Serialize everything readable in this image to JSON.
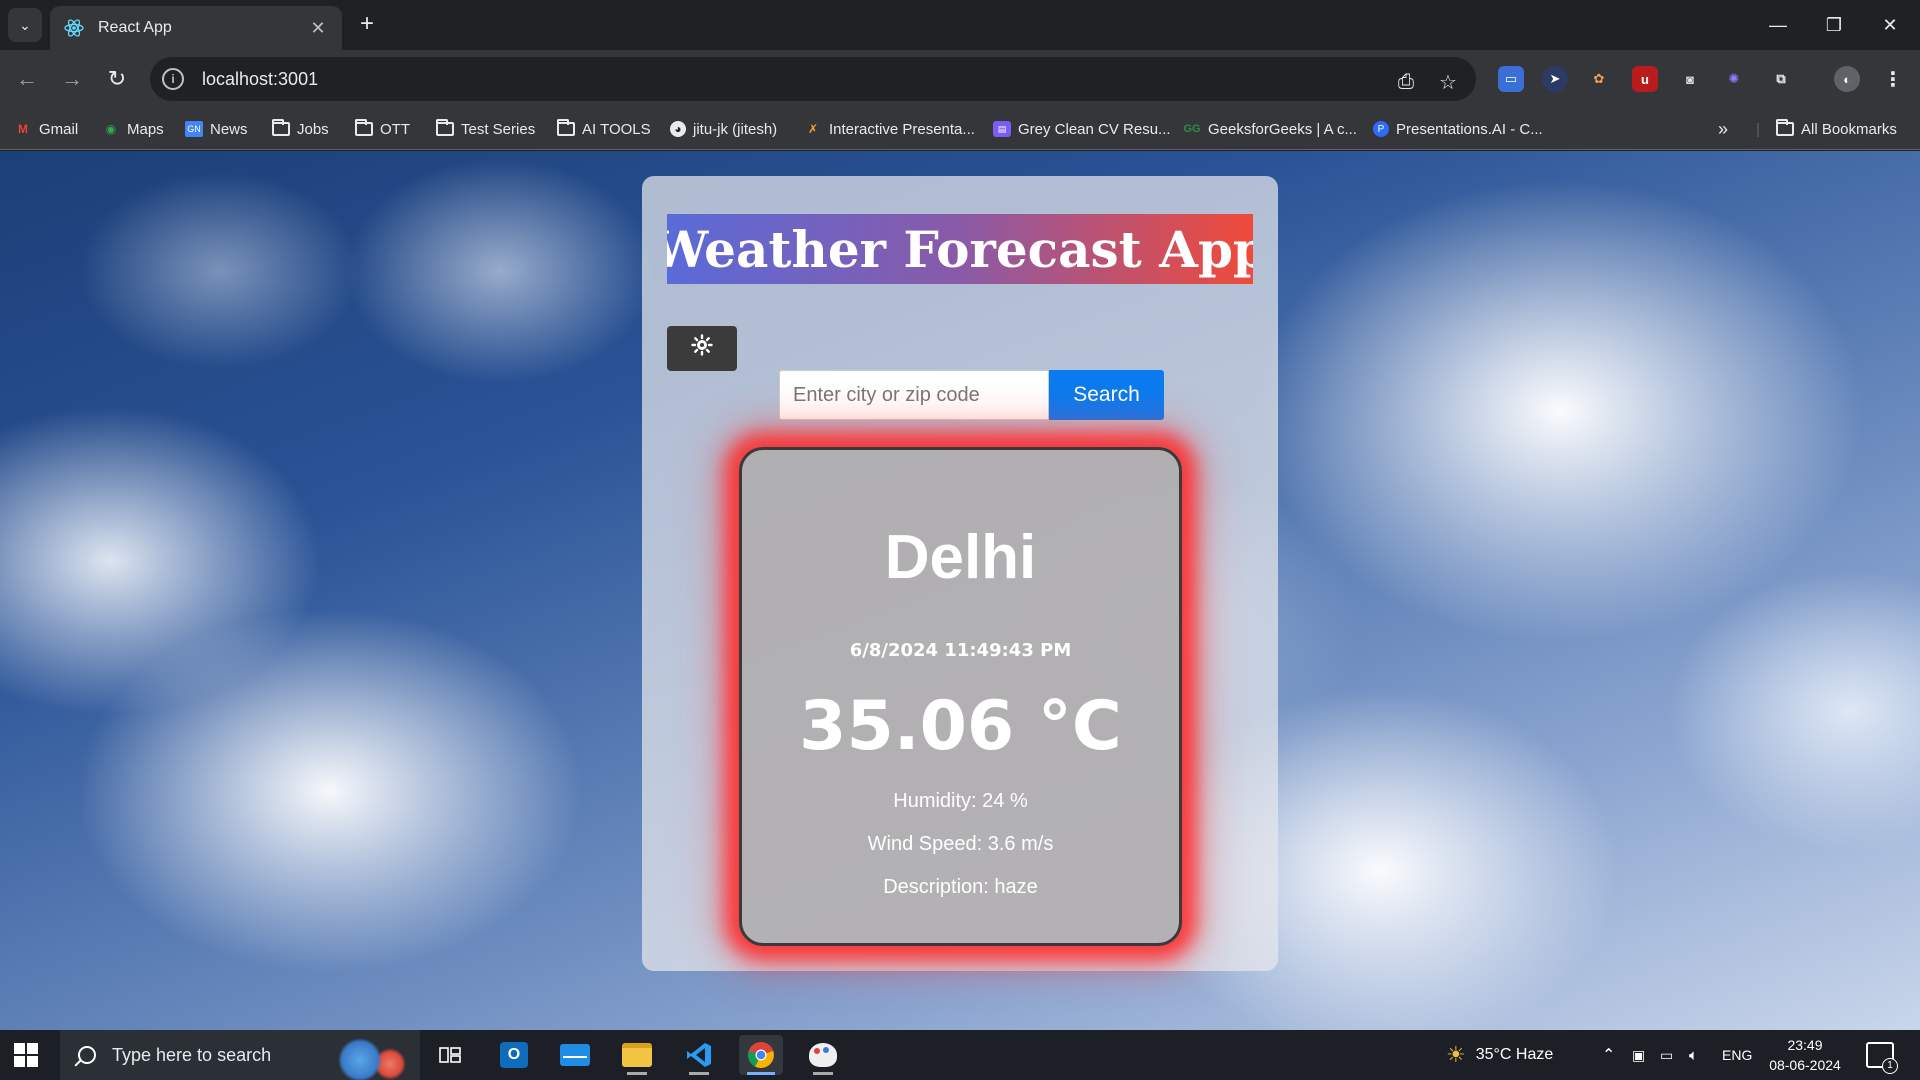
{
  "browser": {
    "tab_title": "React App",
    "url": "localhost:3001",
    "tab_close": "✕",
    "new_tab": "+",
    "bookmarks": [
      {
        "label": "Gmail",
        "icon": "gmail-icon"
      },
      {
        "label": "Maps",
        "icon": "maps-icon"
      },
      {
        "label": "News",
        "icon": "news-icon"
      },
      {
        "label": "Jobs",
        "icon": "folder-icon"
      },
      {
        "label": "OTT",
        "icon": "folder-icon"
      },
      {
        "label": "Test Series",
        "icon": "folder-icon"
      },
      {
        "label": "AI TOOLS",
        "icon": "folder-icon"
      },
      {
        "label": "jitu-jk (jitesh)",
        "icon": "github-icon"
      },
      {
        "label": "Interactive Presenta...",
        "icon": "presentation-icon"
      },
      {
        "label": "Grey Clean CV Resu...",
        "icon": "canva-icon"
      },
      {
        "label": "GeeksforGeeks | A c...",
        "icon": "gfg-icon"
      },
      {
        "label": "Presentations.AI - C...",
        "icon": "presentations-ai-icon"
      }
    ],
    "all_bookmarks": "All Bookmarks"
  },
  "app": {
    "title": "Weather Forecast App",
    "theme_toggle_icon": "sun-icon",
    "search_placeholder": "Enter city or zip code",
    "search_value": "",
    "search_button": "Search",
    "colors": {
      "title_gradient": [
        "#5a6bd8",
        "#f04a3a"
      ],
      "search_button": "#0a7bf0",
      "card_glow": "#ff2828"
    }
  },
  "weather": {
    "city": "Delhi",
    "datetime": "6/8/2024 11:49:43 PM",
    "temperature": "35.06 °C",
    "humidity": "Humidity: 24 %",
    "wind": "Wind Speed: 3.6 m/s",
    "description": "Description: haze"
  },
  "taskbar": {
    "search_placeholder": "Type here to search",
    "weather": "35°C  Haze",
    "language": "ENG",
    "time": "23:49",
    "date": "08-06-2024",
    "notification_count": "1"
  }
}
